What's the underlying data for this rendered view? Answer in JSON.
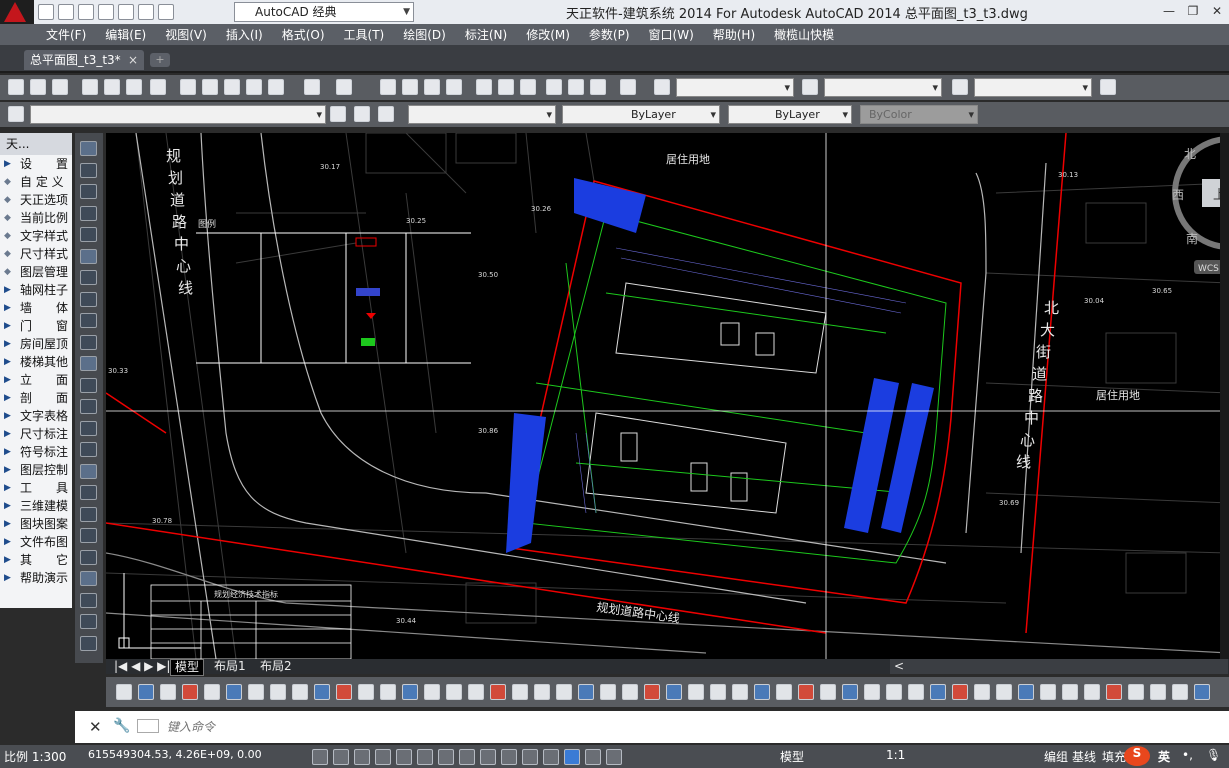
{
  "window": {
    "title": "天正软件-建筑系统 2014  For Autodesk AutoCAD 2014    总平面图_t3_t3.dwg",
    "workspace": "AutoCAD 经典",
    "controls": [
      "—",
      "❐",
      "✕"
    ]
  },
  "menu": [
    "文件(F)",
    "编辑(E)",
    "视图(V)",
    "插入(I)",
    "格式(O)",
    "工具(T)",
    "绘图(D)",
    "标注(N)",
    "修改(M)",
    "参数(P)",
    "窗口(W)",
    "帮助(H)",
    "橄榄山快模"
  ],
  "doc_tab": {
    "label": "总平面图_t3_t3*",
    "close": "×",
    "new": "+"
  },
  "toolbar2": {
    "linetype": "ByLayer",
    "lineweight": "ByLayer",
    "color": "ByColor"
  },
  "left_panel": {
    "title": "天...",
    "items": [
      {
        "label": "设　　置",
        "arrow": true
      },
      {
        "label": "自 定 义",
        "arrow": false
      },
      {
        "label": "天正选项",
        "arrow": false
      },
      {
        "label": "当前比例",
        "arrow": false
      },
      {
        "label": "文字样式",
        "arrow": false
      },
      {
        "label": "尺寸样式",
        "arrow": false
      },
      {
        "label": "图层管理",
        "arrow": false
      },
      {
        "label": "轴网柱子",
        "arrow": true
      },
      {
        "label": "墙　　体",
        "arrow": true
      },
      {
        "label": "门　　窗",
        "arrow": true
      },
      {
        "label": "房间屋顶",
        "arrow": true
      },
      {
        "label": "楼梯其他",
        "arrow": true
      },
      {
        "label": "立　　面",
        "arrow": true
      },
      {
        "label": "剖　　面",
        "arrow": true
      },
      {
        "label": "文字表格",
        "arrow": true
      },
      {
        "label": "尺寸标注",
        "arrow": true
      },
      {
        "label": "符号标注",
        "arrow": true
      },
      {
        "label": "图层控制",
        "arrow": true
      },
      {
        "label": "工　　具",
        "arrow": true
      },
      {
        "label": "三维建模",
        "arrow": true
      },
      {
        "label": "图块图案",
        "arrow": true
      },
      {
        "label": "文件布图",
        "arrow": true
      },
      {
        "label": "其　　它",
        "arrow": true
      },
      {
        "label": "帮助演示",
        "arrow": true
      }
    ]
  },
  "drawing": {
    "road_left": "规划道路中心线",
    "road_right": "北大街道路中心线",
    "road_bottom": "规划道路中心线",
    "residential_top": "居住用地",
    "residential_right": "居住用地",
    "legend_title": "图例",
    "table_title": "规划经济技术指标",
    "compass": {
      "north": "北",
      "west": "西",
      "south": "南",
      "up": "上",
      "wcs": "WCS"
    },
    "elevations": [
      "30.17",
      "30.25",
      "30.26",
      "30.50",
      "30.33",
      "30.86",
      "30.78",
      "30.44",
      "30.13",
      "30.04",
      "30.69",
      "30.65"
    ]
  },
  "layout_tabs": {
    "model": "模型",
    "layout1": "布局1",
    "layout2": "布局2"
  },
  "cmdline": {
    "placeholder": "键入命令"
  },
  "status": {
    "scale": "比例 1:300",
    "coords": "615549304.53, 4.26E+09, 0.00",
    "model": "模型",
    "anno_scale": "1:1",
    "group": "编组",
    "baseline": "基线",
    "fill": "填充",
    "ime": "英"
  },
  "colors": {
    "accent": "#c4161c",
    "menubar": "#5b5f66",
    "canvas": "#000000"
  }
}
